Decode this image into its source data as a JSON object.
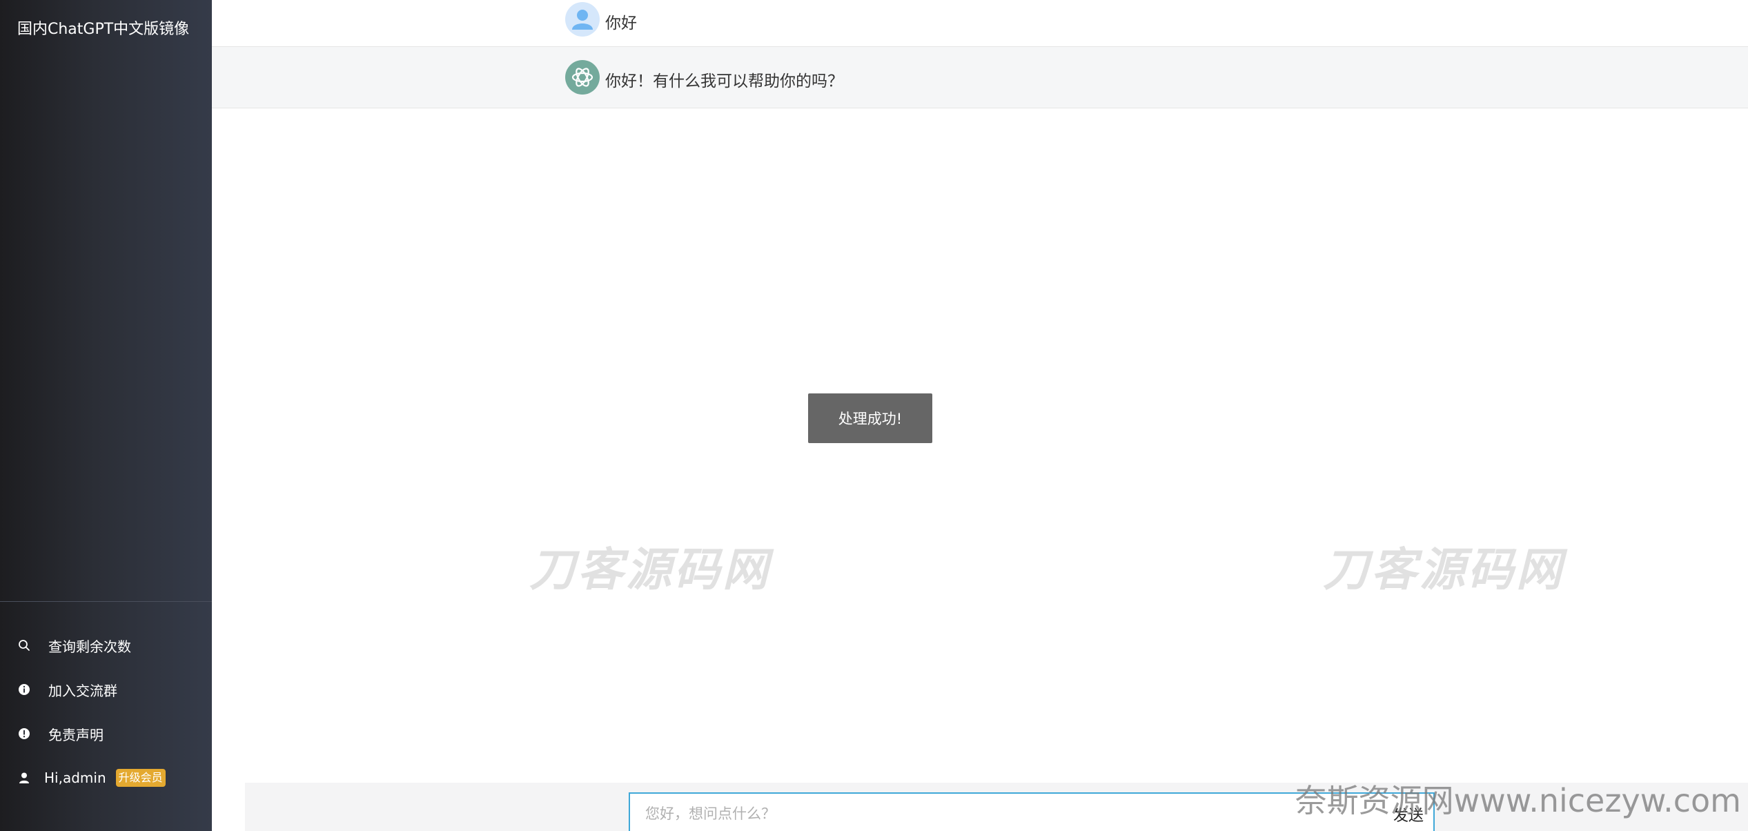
{
  "sidebar": {
    "brand": "国内ChatGPT中文版镜像",
    "items": [
      {
        "label": "查询剩余次数",
        "icon": "search-icon"
      },
      {
        "label": "加入交流群",
        "icon": "info-icon"
      },
      {
        "label": "免责声明",
        "icon": "alert-icon"
      }
    ],
    "user": {
      "label": "Hi,admin",
      "icon": "user-icon",
      "badge": "升级会员"
    }
  },
  "messages": [
    {
      "role": "user",
      "text": "你好",
      "icon": "user-avatar-icon"
    },
    {
      "role": "assistant",
      "text": "你好！有什么我可以帮助你的吗？",
      "icon": "openai-logo-icon"
    }
  ],
  "toast": "处理成功!",
  "watermarks": [
    "刀客源码网",
    "刀客源码网"
  ],
  "input": {
    "placeholder": "您好，想问点什么？",
    "value": "",
    "send_label": "发送"
  },
  "corner_watermark": "奈斯资源网www.nicezyw.com",
  "colors": {
    "accent_border": "#3fa8d8",
    "badge": "#e4a930",
    "assistant_avatar": "#74aa9c"
  }
}
